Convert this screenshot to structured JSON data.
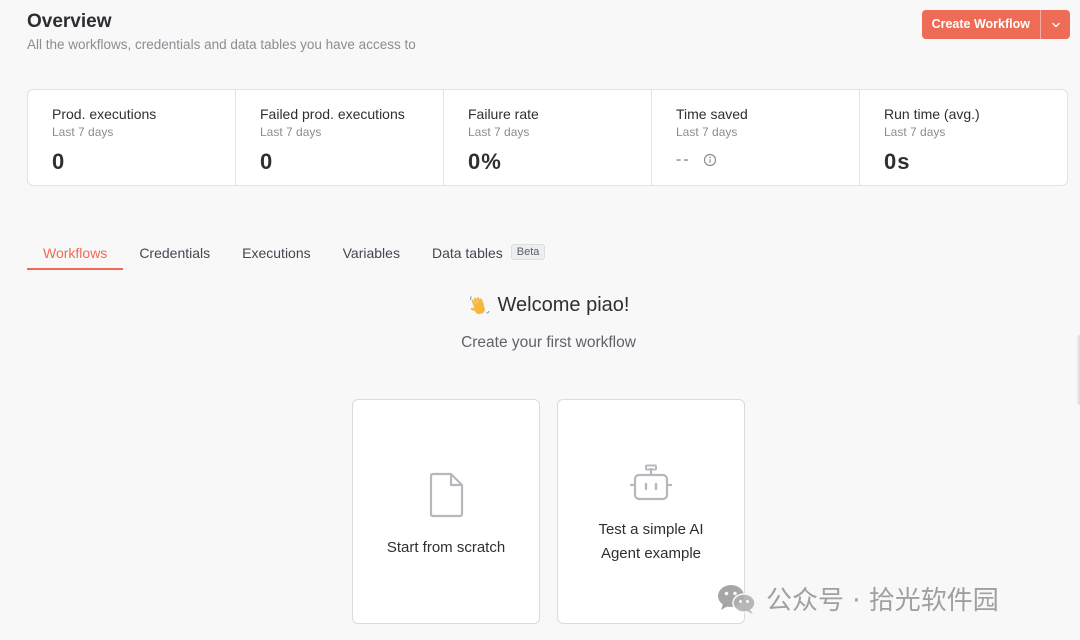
{
  "header": {
    "title": "Overview",
    "subtitle": "All the workflows, credentials and data tables you have access to",
    "create_label": "Create Workflow"
  },
  "stats": [
    {
      "label": "Prod. executions",
      "period": "Last 7 days",
      "value": "0"
    },
    {
      "label": "Failed prod. executions",
      "period": "Last 7 days",
      "value": "0"
    },
    {
      "label": "Failure rate",
      "period": "Last 7 days",
      "value": "0%"
    },
    {
      "label": "Time saved",
      "period": "Last 7 days",
      "value": "--"
    },
    {
      "label": "Run time (avg.)",
      "period": "Last 7 days",
      "value": "0s"
    }
  ],
  "tabs": [
    {
      "label": "Workflows",
      "active": true
    },
    {
      "label": "Credentials"
    },
    {
      "label": "Executions"
    },
    {
      "label": "Variables"
    },
    {
      "label": "Data tables",
      "badge": "Beta"
    }
  ],
  "welcome": {
    "title": "Welcome piao!",
    "subtitle": "Create your first workflow"
  },
  "cards": [
    {
      "label": "Start from scratch",
      "icon": "file-icon"
    },
    {
      "label_line1": "Test a simple AI",
      "label_line2": "Agent example",
      "icon": "robot-icon"
    }
  ],
  "watermark": {
    "text": "公众号 · 拾光软件园"
  },
  "colors": {
    "accent": "#ee6b55",
    "background": "#f8f8f9"
  }
}
